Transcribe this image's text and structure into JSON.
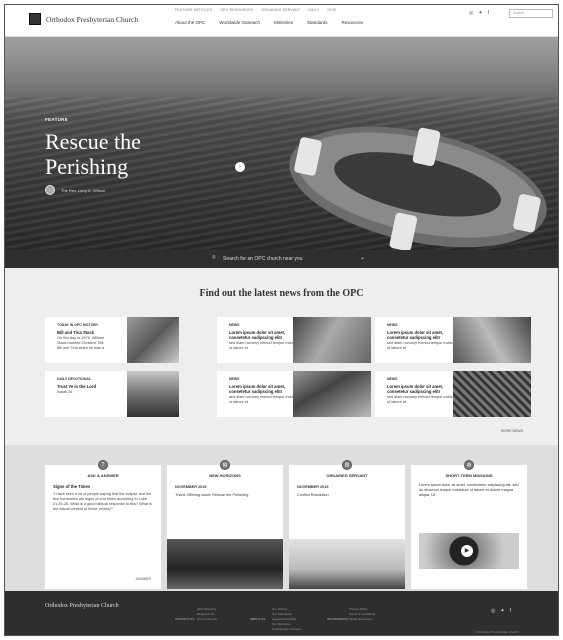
{
  "header": {
    "site_name": "Orthodox Presbyterian Church",
    "utility_nav": [
      "Feature Articles",
      "OPC Resources",
      "Ordained Servant",
      "Daily",
      "Give"
    ],
    "main_nav": [
      "About the OPC",
      "Worldwide Outreach",
      "Ministries",
      "Standards",
      "Resources"
    ],
    "search_placeholder": "Search"
  },
  "hero": {
    "label": "FEATURE",
    "title": "Rescue the Perishing",
    "author": "The Rev. Larry E. Wilson",
    "church_search": "Search for an OPC church near you"
  },
  "news": {
    "section_title": "Find out the latest news from the OPC",
    "cards": [
      {
        "label": "Today in OPC History",
        "head": "Bill and Tina Stack",
        "body": "On this day in 1976, William Stack married Christine Teti. Bill met Tina when he was a"
      },
      {
        "label": "News",
        "head": "Lorem ipsum dolor sit amet, consetetur sadipscing elitr",
        "body": "sed diam nonumy eirmod tempor invidunt ut labore et"
      },
      {
        "label": "News",
        "head": "Lorem ipsum dolor sit amet, consetetur sadipscing elitr",
        "body": "sed diam nonumy eirmod tempor invidunt ut labore et"
      },
      {
        "label": "Daily Devotional",
        "head": "Trust Ye in the Lord",
        "body": "Isaiah 26"
      },
      {
        "label": "News",
        "head": "Lorem ipsum dolor sit amet, consetetur sadipscing elitr",
        "body": "sed diam nonumy eirmod tempor invidunt ut labore et"
      },
      {
        "label": "News",
        "head": "Lorem ipsum dolor sit amet, consetetur sadipscing elitr",
        "body": "sed diam nonumy eirmod tempor invidunt ut labore et"
      }
    ],
    "more_link": "MORE NEWS"
  },
  "columns": {
    "ask": {
      "title": "Ask & Answer",
      "sub": "Signs of the Times",
      "quote": "\"I have seen a lot of people saying that the eclipse and the two hurricanes are signs of end times according to Luke 21:25-26. What is a good biblical response to this? What is the actual content of these verses?\"",
      "link": "ANSWER"
    },
    "horizons": {
      "title": "New Horizons",
      "meta": "November 2019",
      "text": "Thank Offering Issue: Rescue the Perishing"
    },
    "servant": {
      "title": "Ordained Servant",
      "meta": "November 2019",
      "text": "Conflict Resolution"
    },
    "missions": {
      "title": "Short-Term Missions",
      "text": "Lorem ipsum dolor sit amet, consectetur adipiscing elit, sed do eiusmod tempor incididunt ut labore et dolore magna aliqua. Ut"
    }
  },
  "footer": {
    "site_name": "Orthodox Presbyterian Church",
    "groups": [
      {
        "head": "Contact Us",
        "links": [
          "OPC Directory",
          "Religious Lib.",
          "Give to Church"
        ]
      },
      {
        "head": "About Us",
        "links": [
          "Our History",
          "Our Standards",
          "General Assembly",
          "Our Ministries",
          "Presbyteries Contacts"
        ]
      },
      {
        "head": "Information",
        "links": [
          "Privacy Policy",
          "Terms & Conditions",
          "Media Resources"
        ]
      }
    ],
    "copyright": "© Orthodox Presbyterian Church"
  },
  "colors": {
    "footer_bg": "#2e2e2e",
    "hero_dark": "#2a2a2a",
    "section_bg": "#eeeeee"
  }
}
